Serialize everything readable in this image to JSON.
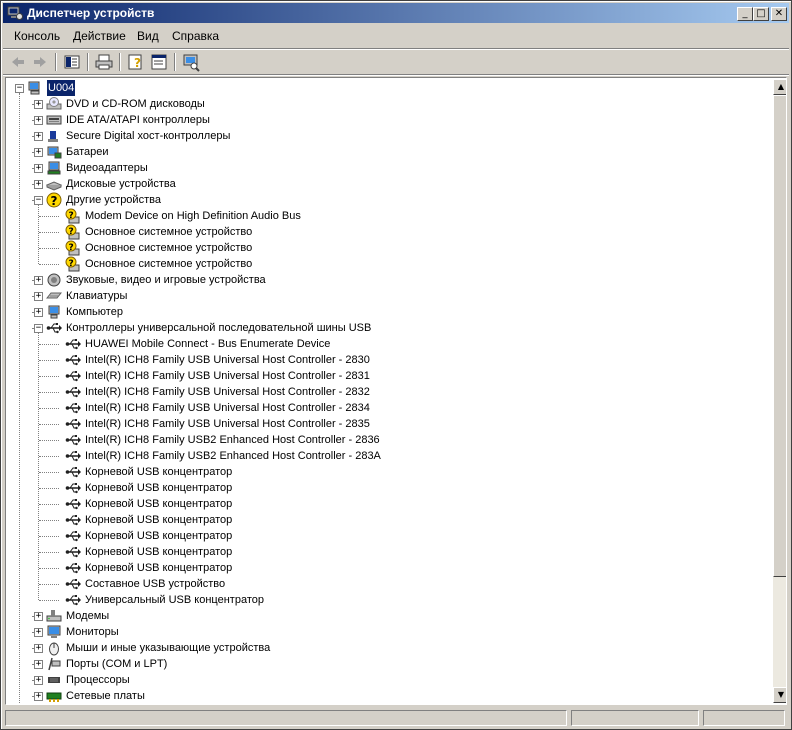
{
  "window": {
    "title": "Диспетчер устройств"
  },
  "menu": [
    {
      "label": "Консоль"
    },
    {
      "label": "Действие"
    },
    {
      "label": "Вид"
    },
    {
      "label": "Справка"
    }
  ],
  "toolbar": [
    "back-arrow-icon",
    "forward-arrow-icon",
    "show-hide-tree-icon",
    "print-icon",
    "properties-help-icon",
    "properties-icon",
    "scan-hardware-icon"
  ],
  "tree": {
    "root": "U004",
    "nodes": [
      {
        "label": "DVD и CD-ROM дисководы",
        "level": 1,
        "expander": "+",
        "icon": "dvd-drive-icon"
      },
      {
        "label": "IDE ATA/ATAPI контроллеры",
        "level": 1,
        "expander": "+",
        "icon": "ide-controller-icon"
      },
      {
        "label": "Secure Digital хост-контроллеры",
        "level": 1,
        "expander": "+",
        "icon": "sd-controller-icon"
      },
      {
        "label": "Батареи",
        "level": 1,
        "expander": "+",
        "icon": "battery-icon"
      },
      {
        "label": "Видеоадаптеры",
        "level": 1,
        "expander": "+",
        "icon": "display-adapter-icon"
      },
      {
        "label": "Дисковые устройства",
        "level": 1,
        "expander": "+",
        "icon": "disk-drive-icon"
      },
      {
        "label": "Другие устройства",
        "level": 1,
        "expander": "-",
        "icon": "unknown-device-icon"
      },
      {
        "label": "Modem Device on High Definition Audio Bus",
        "level": 2,
        "icon": "warning-device-icon"
      },
      {
        "label": "Основное системное устройство",
        "level": 2,
        "icon": "warning-device-icon"
      },
      {
        "label": "Основное системное устройство",
        "level": 2,
        "icon": "warning-device-icon"
      },
      {
        "label": "Основное системное устройство",
        "level": 2,
        "icon": "warning-device-icon"
      },
      {
        "label": "Звуковые, видео и игровые устройства",
        "level": 1,
        "expander": "+",
        "icon": "sound-icon"
      },
      {
        "label": "Клавиатуры",
        "level": 1,
        "expander": "+",
        "icon": "keyboard-icon"
      },
      {
        "label": "Компьютер",
        "level": 1,
        "expander": "+",
        "icon": "computer-icon"
      },
      {
        "label": "Контроллеры универсальной последовательной шины USB",
        "level": 1,
        "expander": "-",
        "icon": "usb-icon"
      },
      {
        "label": "HUAWEI Mobile Connect - Bus Enumerate Device",
        "level": 2,
        "icon": "usb-icon"
      },
      {
        "label": "Intel(R) ICH8 Family USB Universal Host Controller - 2830",
        "level": 2,
        "icon": "usb-icon"
      },
      {
        "label": "Intel(R) ICH8 Family USB Universal Host Controller - 2831",
        "level": 2,
        "icon": "usb-icon"
      },
      {
        "label": "Intel(R) ICH8 Family USB Universal Host Controller - 2832",
        "level": 2,
        "icon": "usb-icon"
      },
      {
        "label": "Intel(R) ICH8 Family USB Universal Host Controller - 2834",
        "level": 2,
        "icon": "usb-icon"
      },
      {
        "label": "Intel(R) ICH8 Family USB Universal Host Controller - 2835",
        "level": 2,
        "icon": "usb-icon"
      },
      {
        "label": "Intel(R) ICH8 Family USB2 Enhanced Host Controller - 2836",
        "level": 2,
        "icon": "usb-icon"
      },
      {
        "label": "Intel(R) ICH8 Family USB2 Enhanced Host Controller - 283A",
        "level": 2,
        "icon": "usb-icon"
      },
      {
        "label": "Корневой USB концентратор",
        "level": 2,
        "icon": "usb-icon"
      },
      {
        "label": "Корневой USB концентратор",
        "level": 2,
        "icon": "usb-icon"
      },
      {
        "label": "Корневой USB концентратор",
        "level": 2,
        "icon": "usb-icon"
      },
      {
        "label": "Корневой USB концентратор",
        "level": 2,
        "icon": "usb-icon"
      },
      {
        "label": "Корневой USB концентратор",
        "level": 2,
        "icon": "usb-icon"
      },
      {
        "label": "Корневой USB концентратор",
        "level": 2,
        "icon": "usb-icon"
      },
      {
        "label": "Корневой USB концентратор",
        "level": 2,
        "icon": "usb-icon"
      },
      {
        "label": "Составное USB устройство",
        "level": 2,
        "icon": "usb-icon"
      },
      {
        "label": "Универсальный USB концентратор",
        "level": 2,
        "icon": "usb-icon"
      },
      {
        "label": "Модемы",
        "level": 1,
        "expander": "+",
        "icon": "modem-icon"
      },
      {
        "label": "Мониторы",
        "level": 1,
        "expander": "+",
        "icon": "monitor-icon"
      },
      {
        "label": "Мыши и иные указывающие устройства",
        "level": 1,
        "expander": "+",
        "icon": "mouse-icon"
      },
      {
        "label": "Порты (COM и LPT)",
        "level": 1,
        "expander": "+",
        "icon": "port-icon"
      },
      {
        "label": "Процессоры",
        "level": 1,
        "expander": "+",
        "icon": "processor-icon"
      },
      {
        "label": "Сетевые платы",
        "level": 1,
        "expander": "+",
        "icon": "network-adapter-icon"
      }
    ]
  },
  "colors": {
    "title_start": "#0a246a",
    "title_end": "#a6caf0",
    "selection": "#0a246a",
    "warning": "#ffd800"
  }
}
